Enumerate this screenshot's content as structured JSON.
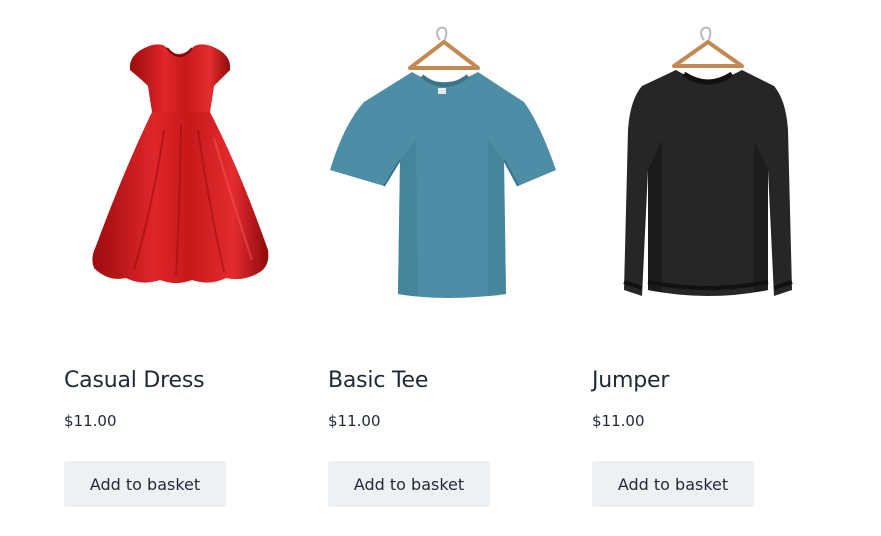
{
  "products": [
    {
      "title": "Casual Dress",
      "price": "$11.00",
      "button_label": "Add to basket",
      "image_icon": "red-dress-image",
      "color": "#c8191a"
    },
    {
      "title": "Basic Tee",
      "price": "$11.00",
      "button_label": "Add to basket",
      "image_icon": "blue-tshirt-image",
      "color": "#4d8ea6"
    },
    {
      "title": "Jumper",
      "price": "$11.00",
      "button_label": "Add to basket",
      "image_icon": "black-sweater-image",
      "color": "#262626"
    }
  ]
}
